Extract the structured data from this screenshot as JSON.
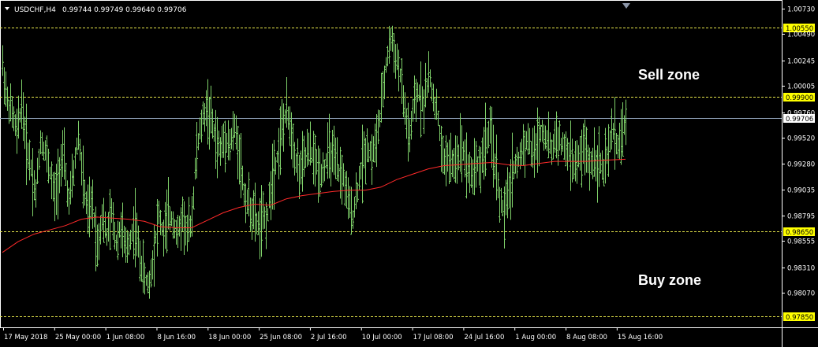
{
  "header": {
    "symbol_label": "USDCHF,H4",
    "ohlc_label": "0.99744 0.99749 0.99640 0.99706",
    "menu_icon": "triangle-down-icon"
  },
  "colors": {
    "background": "#000000",
    "bars": "#7fd16a",
    "moving_average": "#ff2a2a",
    "level_lines": "#e6e64a",
    "level_badge": "#ffff00",
    "current_price_line": "#8ea0b8",
    "axis_text": "#ffffff"
  },
  "annotations": {
    "sell_zone": "Sell zone",
    "buy_zone": "Buy zone"
  },
  "chart_data": {
    "type": "ohlc",
    "symbol": "USDCHF",
    "timeframe": "H4",
    "ylim": [
      0.9775,
      1.008
    ],
    "y_ticks": [
      "1.00730",
      "1.00490",
      "1.00245",
      "1.00005",
      "0.99760",
      "0.99520",
      "0.99280",
      "0.99035",
      "0.98795",
      "0.98555",
      "0.98310",
      "0.98070"
    ],
    "x_ticks": [
      "17 May 2018",
      "25 May 00:00",
      "1 Jun 08:00",
      "8 Jun 16:00",
      "18 Jun 00:00",
      "25 Jun 08:00",
      "2 Jul 16:00",
      "10 Jul 00:00",
      "17 Jul 08:00",
      "24 Jul 16:00",
      "1 Aug 00:00",
      "8 Aug 08:00",
      "15 Aug 16:00"
    ],
    "levels": [
      {
        "label": "1.00550",
        "value": 1.0055
      },
      {
        "label": "0.99900",
        "value": 0.999
      },
      {
        "label": "0.98650",
        "value": 0.9865
      },
      {
        "label": "0.97850",
        "value": 0.9785
      }
    ],
    "current_price": {
      "label": "0.99706",
      "value": 0.99706
    },
    "series": [
      {
        "kind": "price",
        "points": [
          [
            0,
            1.002
          ],
          [
            6,
            0.9985
          ],
          [
            12,
            0.9975
          ],
          [
            18,
            0.9955
          ],
          [
            24,
            0.9985
          ],
          [
            30,
            0.9945
          ],
          [
            36,
            0.9925
          ],
          [
            42,
            0.99
          ],
          [
            48,
            0.995
          ],
          [
            54,
            0.994
          ],
          [
            60,
            0.992
          ],
          [
            66,
            0.9895
          ],
          [
            72,
            0.9925
          ],
          [
            78,
            0.993
          ],
          [
            84,
            0.989
          ],
          [
            90,
            0.992
          ],
          [
            96,
            0.9955
          ],
          [
            102,
            0.991
          ],
          [
            108,
            0.988
          ],
          [
            114,
            0.989
          ],
          [
            120,
            0.985
          ],
          [
            126,
            0.988
          ],
          [
            132,
            0.986
          ],
          [
            138,
            0.988
          ],
          [
            144,
            0.9855
          ],
          [
            150,
            0.987
          ],
          [
            156,
            0.9845
          ],
          [
            162,
            0.986
          ],
          [
            168,
            0.987
          ],
          [
            174,
            0.984
          ],
          [
            180,
            0.982
          ],
          [
            186,
            0.9815
          ],
          [
            192,
            0.985
          ],
          [
            198,
            0.988
          ],
          [
            204,
            0.986
          ],
          [
            210,
            0.988
          ],
          [
            216,
            0.9875
          ],
          [
            222,
            0.986
          ],
          [
            228,
            0.988
          ],
          [
            234,
            0.986
          ],
          [
            240,
            0.988
          ],
          [
            246,
            0.994
          ],
          [
            252,
            0.9965
          ],
          [
            258,
            0.998
          ],
          [
            264,
            0.997
          ],
          [
            270,
            0.995
          ],
          [
            276,
            0.994
          ],
          [
            282,
            0.9955
          ],
          [
            288,
            0.9945
          ],
          [
            294,
            0.996
          ],
          [
            300,
            0.994
          ],
          [
            306,
            0.99
          ],
          [
            312,
            0.989
          ],
          [
            318,
            0.988
          ],
          [
            324,
            0.987
          ],
          [
            330,
            0.9875
          ],
          [
            336,
            0.988
          ],
          [
            342,
            0.992
          ],
          [
            348,
            0.9935
          ],
          [
            354,
            0.996
          ],
          [
            360,
            0.9975
          ],
          [
            366,
            0.996
          ],
          [
            372,
            0.993
          ],
          [
            378,
            0.992
          ],
          [
            384,
            0.9935
          ],
          [
            390,
            0.994
          ],
          [
            396,
            0.993
          ],
          [
            402,
            0.992
          ],
          [
            408,
            0.9925
          ],
          [
            414,
            0.994
          ],
          [
            420,
            0.993
          ],
          [
            426,
            0.992
          ],
          [
            432,
            0.9915
          ],
          [
            438,
            0.989
          ],
          [
            444,
            0.988
          ],
          [
            450,
            0.9905
          ],
          [
            456,
            0.993
          ],
          [
            462,
            0.9945
          ],
          [
            468,
            0.9935
          ],
          [
            474,
            0.995
          ],
          [
            480,
            0.998
          ],
          [
            486,
            1.002
          ],
          [
            492,
            1.0045
          ],
          [
            498,
            1.003
          ],
          [
            504,
            1.001
          ],
          [
            510,
            0.9975
          ],
          [
            516,
            0.995
          ],
          [
            522,
            0.9985
          ],
          [
            528,
            0.9995
          ],
          [
            534,
            0.9985
          ],
          [
            540,
            1.001
          ],
          [
            546,
            0.999
          ],
          [
            552,
            0.997
          ],
          [
            558,
            0.993
          ],
          [
            564,
            0.9935
          ],
          [
            570,
            0.9925
          ],
          [
            576,
            0.9935
          ],
          [
            582,
            0.9945
          ],
          [
            588,
            0.993
          ],
          [
            594,
            0.9915
          ],
          [
            600,
            0.993
          ],
          [
            606,
            0.9925
          ],
          [
            612,
            0.995
          ],
          [
            618,
            0.9955
          ],
          [
            624,
            0.993
          ],
          [
            630,
            0.9895
          ],
          [
            636,
            0.988
          ],
          [
            642,
            0.9905
          ],
          [
            648,
            0.9925
          ],
          [
            654,
            0.993
          ],
          [
            660,
            0.9945
          ],
          [
            666,
            0.995
          ],
          [
            672,
            0.9935
          ],
          [
            678,
            0.995
          ],
          [
            684,
            0.996
          ],
          [
            690,
            0.995
          ],
          [
            696,
            0.994
          ],
          [
            702,
            0.9955
          ],
          [
            708,
            0.9945
          ],
          [
            714,
            0.994
          ],
          [
            720,
            0.9935
          ],
          [
            726,
            0.9925
          ],
          [
            732,
            0.9935
          ],
          [
            738,
            0.9945
          ],
          [
            744,
            0.9925
          ],
          [
            750,
            0.9935
          ],
          [
            756,
            0.993
          ],
          [
            762,
            0.992
          ],
          [
            768,
            0.994
          ],
          [
            774,
            0.996
          ],
          [
            780,
            0.9945
          ],
          [
            786,
            0.9955
          ],
          [
            790,
            0.99706
          ]
        ]
      },
      {
        "kind": "moving_average",
        "points": [
          [
            0,
            0.9845
          ],
          [
            20,
            0.9855
          ],
          [
            40,
            0.9862
          ],
          [
            60,
            0.9866
          ],
          [
            80,
            0.987
          ],
          [
            100,
            0.9876
          ],
          [
            120,
            0.9878
          ],
          [
            140,
            0.9877
          ],
          [
            160,
            0.9876
          ],
          [
            180,
            0.9874
          ],
          [
            200,
            0.9869
          ],
          [
            220,
            0.9868
          ],
          [
            240,
            0.9868
          ],
          [
            260,
            0.9875
          ],
          [
            280,
            0.9882
          ],
          [
            300,
            0.9887
          ],
          [
            320,
            0.989
          ],
          [
            340,
            0.9889
          ],
          [
            360,
            0.9895
          ],
          [
            380,
            0.9898
          ],
          [
            400,
            0.99
          ],
          [
            420,
            0.9902
          ],
          [
            440,
            0.9903
          ],
          [
            460,
            0.9903
          ],
          [
            480,
            0.9906
          ],
          [
            500,
            0.9913
          ],
          [
            520,
            0.9918
          ],
          [
            540,
            0.9923
          ],
          [
            560,
            0.9926
          ],
          [
            580,
            0.9927
          ],
          [
            600,
            0.9928
          ],
          [
            620,
            0.9929
          ],
          [
            640,
            0.9927
          ],
          [
            660,
            0.9926
          ],
          [
            680,
            0.9928
          ],
          [
            700,
            0.993
          ],
          [
            720,
            0.993
          ],
          [
            740,
            0.993
          ],
          [
            760,
            0.9931
          ],
          [
            790,
            0.9932
          ]
        ]
      }
    ]
  }
}
